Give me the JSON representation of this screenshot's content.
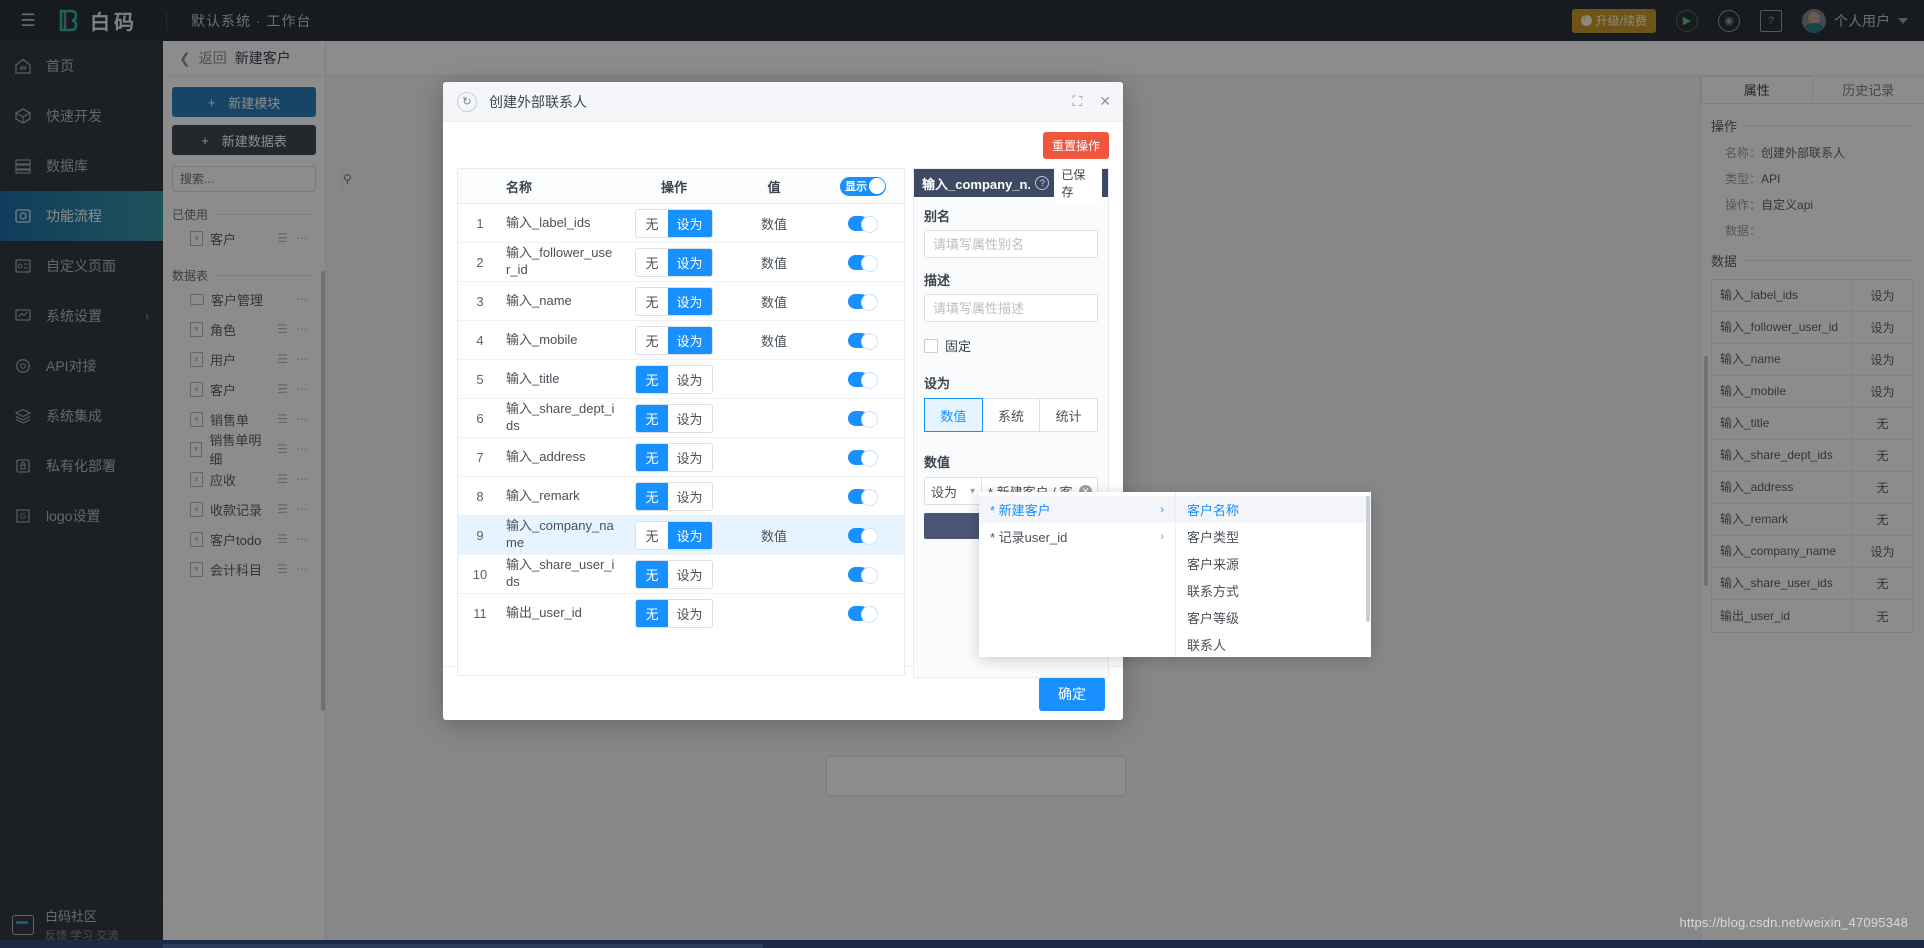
{
  "topbar": {
    "burger_icon": "menu-icon",
    "brand": "白码",
    "context": "默认系统 · 工作台",
    "upgrade_label": "升级/续费",
    "play_icon": "play-circle-icon",
    "support_icon": "headset-icon",
    "help_icon": "help-book-icon",
    "user_name": "个人用户"
  },
  "leftnav": {
    "items": [
      {
        "label": "首页",
        "icon": "home-icon",
        "active": false
      },
      {
        "label": "快速开发",
        "icon": "cube-icon",
        "active": false
      },
      {
        "label": "数据库",
        "icon": "database-icon",
        "active": false
      },
      {
        "label": "功能流程",
        "icon": "flow-icon",
        "active": true
      },
      {
        "label": "自定义页面",
        "icon": "page-icon",
        "active": false
      },
      {
        "label": "系统设置",
        "icon": "monitor-icon",
        "active": false,
        "chevron": "›"
      },
      {
        "label": "API对接",
        "icon": "api-icon",
        "active": false
      },
      {
        "label": "系统集成",
        "icon": "layers-icon",
        "active": false
      },
      {
        "label": "私有化部署",
        "icon": "lock-icon",
        "active": false
      },
      {
        "label": "logo设置",
        "icon": "logo-icon",
        "active": false
      }
    ],
    "footer": {
      "title": "白码社区",
      "subtitle": "反馈·学习·交流",
      "icon": "chat-icon"
    }
  },
  "modpanel": {
    "back_label": "返回",
    "back_icon": "chevron-left-icon",
    "title": "新建客户",
    "new_module": "新建模块",
    "new_table": "新建数据表",
    "search_placeholder": "搜索...",
    "search_value": "",
    "search_icon": "search-icon",
    "group_used": "已使用",
    "group_tables": "数据表",
    "used_items": [
      {
        "label": "客户",
        "icon": "file-icon",
        "has_filter": true
      }
    ],
    "table_items": [
      {
        "label": "客户管理",
        "icon": "folder-icon",
        "has_filter": false
      },
      {
        "label": "角色",
        "icon": "file-icon",
        "has_filter": true
      },
      {
        "label": "用户",
        "icon": "file-icon",
        "has_filter": true
      },
      {
        "label": "客户",
        "icon": "file-icon",
        "has_filter": true
      },
      {
        "label": "销售单",
        "icon": "file-icon",
        "has_filter": true
      },
      {
        "label": "销售单明细",
        "icon": "file-icon",
        "has_filter": true
      },
      {
        "label": "应收",
        "icon": "file-icon",
        "has_filter": true
      },
      {
        "label": "收款记录",
        "icon": "file-icon",
        "has_filter": true
      },
      {
        "label": "客户todo",
        "icon": "file-icon",
        "has_filter": true
      },
      {
        "label": "会计科目",
        "icon": "file-icon",
        "has_filter": true
      }
    ]
  },
  "rightpanel": {
    "tabs": [
      {
        "label": "属性",
        "active": true
      },
      {
        "label": "历史记录",
        "active": false
      }
    ],
    "section_operation": "操作",
    "kv": [
      {
        "key": "名称：",
        "value": "创建外部联系人"
      },
      {
        "key": "类型：",
        "value": "API"
      },
      {
        "key": "操作：",
        "value": "自定义api"
      },
      {
        "key": "数据：",
        "value": ""
      }
    ],
    "section_data": "数据",
    "rows": [
      {
        "name": "输入_label_ids",
        "op": "设为"
      },
      {
        "name": "输入_follower_user_id",
        "op": "设为"
      },
      {
        "name": "输入_name",
        "op": "设为"
      },
      {
        "name": "输入_mobile",
        "op": "设为"
      },
      {
        "name": "输入_title",
        "op": "无"
      },
      {
        "name": "输入_share_dept_ids",
        "op": "无"
      },
      {
        "name": "输入_address",
        "op": "无"
      },
      {
        "name": "输入_remark",
        "op": "无"
      },
      {
        "name": "输入_company_name",
        "op": "设为"
      },
      {
        "name": "输入_share_user_ids",
        "op": "无"
      },
      {
        "name": "输出_user_id",
        "op": "无"
      }
    ]
  },
  "modal": {
    "refresh_icon": "refresh-icon",
    "title": "创建外部联系人",
    "expand_icon": "expand-icon",
    "close_icon": "close-icon",
    "reset_label": "重置操作",
    "confirm_label": "确定",
    "table": {
      "headers": {
        "index": "",
        "name": "名称",
        "op": "操作",
        "value": "值",
        "toggle": "显示"
      },
      "header_toggle_on": true,
      "rows": [
        {
          "index": "1",
          "name": "输入_label_ids",
          "op_none": "无",
          "op_set": "设为",
          "op_active": "set",
          "value": "数值",
          "toggle": true,
          "selected": false
        },
        {
          "index": "2",
          "name": "输入_follower_user_id",
          "op_none": "无",
          "op_set": "设为",
          "op_active": "set",
          "value": "数值",
          "toggle": true,
          "selected": false
        },
        {
          "index": "3",
          "name": "输入_name",
          "op_none": "无",
          "op_set": "设为",
          "op_active": "set",
          "value": "数值",
          "toggle": true,
          "selected": false
        },
        {
          "index": "4",
          "name": "输入_mobile",
          "op_none": "无",
          "op_set": "设为",
          "op_active": "set",
          "value": "数值",
          "toggle": true,
          "selected": false
        },
        {
          "index": "5",
          "name": "输入_title",
          "op_none": "无",
          "op_set": "设为",
          "op_active": "none",
          "value": "",
          "toggle": true,
          "selected": false
        },
        {
          "index": "6",
          "name": "输入_share_dept_ids",
          "op_none": "无",
          "op_set": "设为",
          "op_active": "none",
          "value": "",
          "toggle": true,
          "selected": false
        },
        {
          "index": "7",
          "name": "输入_address",
          "op_none": "无",
          "op_set": "设为",
          "op_active": "none",
          "value": "",
          "toggle": true,
          "selected": false
        },
        {
          "index": "8",
          "name": "输入_remark",
          "op_none": "无",
          "op_set": "设为",
          "op_active": "none",
          "value": "",
          "toggle": true,
          "selected": false
        },
        {
          "index": "9",
          "name": "输入_company_name",
          "op_none": "无",
          "op_set": "设为",
          "op_active": "set",
          "value": "数值",
          "toggle": true,
          "selected": true
        },
        {
          "index": "10",
          "name": "输入_share_user_ids",
          "op_none": "无",
          "op_set": "设为",
          "op_active": "none",
          "value": "",
          "toggle": true,
          "selected": false
        },
        {
          "index": "11",
          "name": "输出_user_id",
          "op_none": "无",
          "op_set": "设为",
          "op_active": "none",
          "value": "",
          "toggle": true,
          "selected": false
        }
      ]
    },
    "form": {
      "header_title": "输入_company_n...",
      "help_icon": "question-icon",
      "saved_label": "已保存",
      "alias_label": "别名",
      "alias_value": "",
      "alias_placeholder": "请填写属性别名",
      "desc_label": "描述",
      "desc_value": "",
      "desc_placeholder": "请填写属性描述",
      "fixed_label": "固定",
      "fixed_checked": false,
      "setas_label": "设为",
      "setas_options": [
        {
          "label": "数值",
          "active": true
        },
        {
          "label": "系统",
          "active": false
        },
        {
          "label": "统计",
          "active": false
        }
      ],
      "value_label": "数值",
      "value_mode": "设为",
      "value_mode_icon": "chevron-down-icon",
      "value_tag": "* 新建客户 / 客",
      "clear_icon": "clear-circle-icon"
    }
  },
  "cascader": {
    "col1": [
      {
        "label": "* 新建客户",
        "arrow": "›",
        "highlighted": true
      },
      {
        "label": "* 记录user_id",
        "arrow": "›",
        "highlighted": false
      }
    ],
    "col2": [
      {
        "label": "客户名称",
        "highlighted": true
      },
      {
        "label": "客户类型",
        "highlighted": false
      },
      {
        "label": "客户来源",
        "highlighted": false
      },
      {
        "label": "联系方式",
        "highlighted": false
      },
      {
        "label": "客户等级",
        "highlighted": false
      },
      {
        "label": "联系人",
        "highlighted": false
      }
    ]
  },
  "watermark": "https://blog.csdn.net/weixin_47095348",
  "colors": {
    "accent": "#1890ff",
    "nav_active_start": "#1e6fa8",
    "nav_active_end": "#3a95a6",
    "danger": "#f0563c",
    "topbar_bg": "#2b3138",
    "leftnav_bg": "#343a40",
    "form_header_bg": "#3d4a63"
  }
}
